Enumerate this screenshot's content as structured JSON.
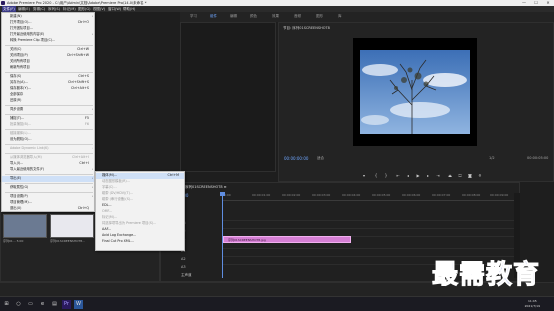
{
  "titlebar": {
    "title": "Adobe Premiere Pro 2020 - C:\\用户\\Admin\\文档\\Adobe\\Premiere Pro\\14.0\\未命名 *",
    "minimize": "—",
    "maximize": "☐",
    "close": "✕"
  },
  "menubar": {
    "items": [
      "文件(F)",
      "编辑(E)",
      "剪辑(C)",
      "序列(S)",
      "标记(M)",
      "图形(G)",
      "视图(V)",
      "窗口(W)",
      "帮助(H)"
    ]
  },
  "workspaces": {
    "items": [
      "学习",
      "组件",
      "编辑",
      "颜色",
      "效果",
      "音频",
      "图形",
      "库"
    ],
    "selected": "组件"
  },
  "file_menu": {
    "items": [
      {
        "label": "新建(N)",
        "shortcut": "",
        "arrow": "›",
        "disabled": false
      },
      {
        "label": "打开项目(O)...",
        "shortcut": "Ctrl+O",
        "disabled": false
      },
      {
        "label": "打开团队项目...",
        "shortcut": "",
        "disabled": false
      },
      {
        "label": "打开最近使用的内容(E)",
        "shortcut": "",
        "arrow": "›",
        "disabled": false
      },
      {
        "label": "转换 Premiere Clip 项目(C)...",
        "shortcut": "",
        "disabled": false
      },
      {
        "label": "关闭(C)",
        "shortcut": "Ctrl+W",
        "disabled": false
      },
      {
        "label": "关闭项目(P)",
        "shortcut": "Ctrl+Shift+W",
        "disabled": false
      },
      {
        "label": "关闭所有项目",
        "shortcut": "",
        "disabled": false
      },
      {
        "label": "刷新所有项目",
        "shortcut": "",
        "disabled": false
      },
      {
        "label": "保存(S)",
        "shortcut": "Ctrl+S",
        "disabled": false
      },
      {
        "label": "另存为(A)...",
        "shortcut": "Ctrl+Shift+S",
        "disabled": false
      },
      {
        "label": "保存副本(Y)...",
        "shortcut": "Ctrl+Alt+S",
        "disabled": false
      },
      {
        "label": "全部保存",
        "shortcut": "",
        "disabled": false
      },
      {
        "label": "还原(R)",
        "shortcut": "",
        "disabled": false
      },
      {
        "label": "同步设置",
        "shortcut": "",
        "arrow": "›",
        "disabled": false
      },
      {
        "label": "捕捉(T)...",
        "shortcut": "F5",
        "disabled": false
      },
      {
        "label": "批量捕捉(B)...",
        "shortcut": "F6",
        "disabled": true
      },
      {
        "label": "链接媒体(L)...",
        "shortcut": "",
        "disabled": true
      },
      {
        "label": "设为脱机(O)...",
        "shortcut": "",
        "disabled": false
      },
      {
        "label": "Adobe Dynamic Link(K)",
        "shortcut": "",
        "arrow": "›",
        "disabled": true
      },
      {
        "label": "从媒体浏览器导入(M)",
        "shortcut": "Ctrl+Alt+I",
        "disabled": true
      },
      {
        "label": "导入(I)...",
        "shortcut": "Ctrl+I",
        "disabled": false
      },
      {
        "label": "导入最近使用的文件(F)",
        "shortcut": "",
        "arrow": "›",
        "disabled": false
      },
      {
        "label": "导出(E)",
        "shortcut": "",
        "arrow": "›",
        "disabled": false,
        "highlight": true
      },
      {
        "label": "获取属性(G)",
        "shortcut": "",
        "arrow": "›",
        "disabled": false
      },
      {
        "label": "项目设置(P)",
        "shortcut": "",
        "arrow": "›",
        "disabled": false
      },
      {
        "label": "项目管理(M)...",
        "shortcut": "",
        "disabled": false
      },
      {
        "label": "退出(X)",
        "shortcut": "Ctrl+Q",
        "disabled": false
      }
    ]
  },
  "export_submenu": {
    "items": [
      {
        "label": "媒体(M)...",
        "shortcut": "Ctrl+M",
        "disabled": false,
        "highlight": true
      },
      {
        "label": "动态图形模板(R)...",
        "shortcut": "",
        "disabled": true
      },
      {
        "label": "字幕(C)...",
        "shortcut": "",
        "disabled": true
      },
      {
        "label": "磁带 (DV/HDV)(T)...",
        "shortcut": "",
        "disabled": true
      },
      {
        "label": "磁带 (串行设备)(S)...",
        "shortcut": "",
        "disabled": true
      },
      {
        "label": "EDL...",
        "shortcut": "",
        "disabled": false
      },
      {
        "label": "OMF...",
        "shortcut": "",
        "disabled": true
      },
      {
        "label": "标记(M)...",
        "shortcut": "",
        "disabled": true
      },
      {
        "label": "将选择项导出为 Premiere 项目(S)...",
        "shortcut": "",
        "disabled": true
      },
      {
        "label": "AAF...",
        "shortcut": "",
        "disabled": false
      },
      {
        "label": "Avid Log Exchange...",
        "shortcut": "",
        "disabled": false
      },
      {
        "label": "Final Cut Pro XML...",
        "shortcut": "",
        "disabled": false
      }
    ]
  },
  "program_monitor": {
    "title": "节目: 序列01SCREENSHOT8",
    "timecode": "00:00:00:00",
    "fit": "适合",
    "quality": "1/2",
    "duration": "00:00:05:00"
  },
  "timeline": {
    "tab": "序列01SCREENSHOT8 ≡",
    "timecode": "00:00:00:00",
    "ruler_ticks": [
      "00:00",
      "00:00:01:00",
      "00:00:02:00",
      "00:00:03:00",
      "00:00:04:00",
      "00:00:05:00",
      "00:00:06:00",
      "00:00:07:00",
      "00:00:08:00",
      "00:00:09:00"
    ],
    "tracks": [
      "V3",
      "V2",
      "V1",
      "A1",
      "A2",
      "A3",
      "主声道"
    ],
    "clip_label": "序列01SCREENSHOT8.jpg"
  },
  "project": {
    "thumb_labels": [
      "序列01... 5:00",
      "序列01SCREENSHOT8..."
    ]
  },
  "taskbar": {
    "time": "11:45",
    "date": "2021/7/19"
  },
  "watermark": "最需教育",
  "colors": {
    "accent": "#6ea6ff",
    "clip": "#d57fd4",
    "watermark": "#1a2fbf"
  }
}
